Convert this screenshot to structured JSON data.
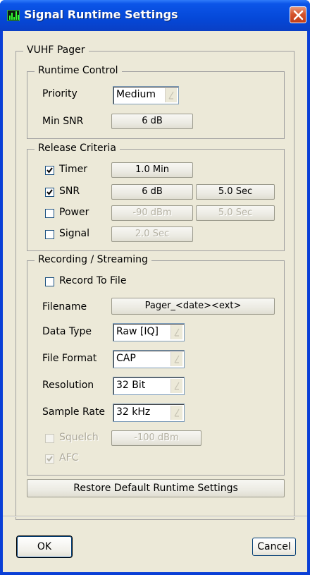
{
  "window": {
    "title": "Signal Runtime Settings"
  },
  "vuhf": {
    "title": "VUHF Pager"
  },
  "runtime": {
    "title": "Runtime Control",
    "priority_label": "Priority",
    "priority_value": "Medium",
    "minsnr_label": "Min SNR",
    "minsnr_value": "6 dB"
  },
  "release": {
    "title": "Release Criteria",
    "timer_label": "Timer",
    "timer_value": "1.0 Min",
    "snr_label": "SNR",
    "snr_value": "6 dB",
    "snr_time": "5.0 Sec",
    "power_label": "Power",
    "power_value": "-90 dBm",
    "power_time": "5.0 Sec",
    "signal_label": "Signal",
    "signal_time": "2.0 Sec"
  },
  "recording": {
    "title": "Recording / Streaming",
    "record_label": "Record To File",
    "filename_label": "Filename",
    "filename_value": "Pager_<date><ext>",
    "datatype_label": "Data Type",
    "datatype_value": "Raw [IQ]",
    "fileformat_label": "File Format",
    "fileformat_value": "CAP",
    "resolution_label": "Resolution",
    "resolution_value": "32 Bit",
    "samplerate_label": "Sample Rate",
    "samplerate_value": "32 kHz",
    "squelch_label": "Squelch",
    "squelch_value": "-100 dBm",
    "afc_label": "AFC"
  },
  "restore_label": "Restore Default Runtime Settings",
  "ok_label": "OK",
  "cancel_label": "Cancel"
}
